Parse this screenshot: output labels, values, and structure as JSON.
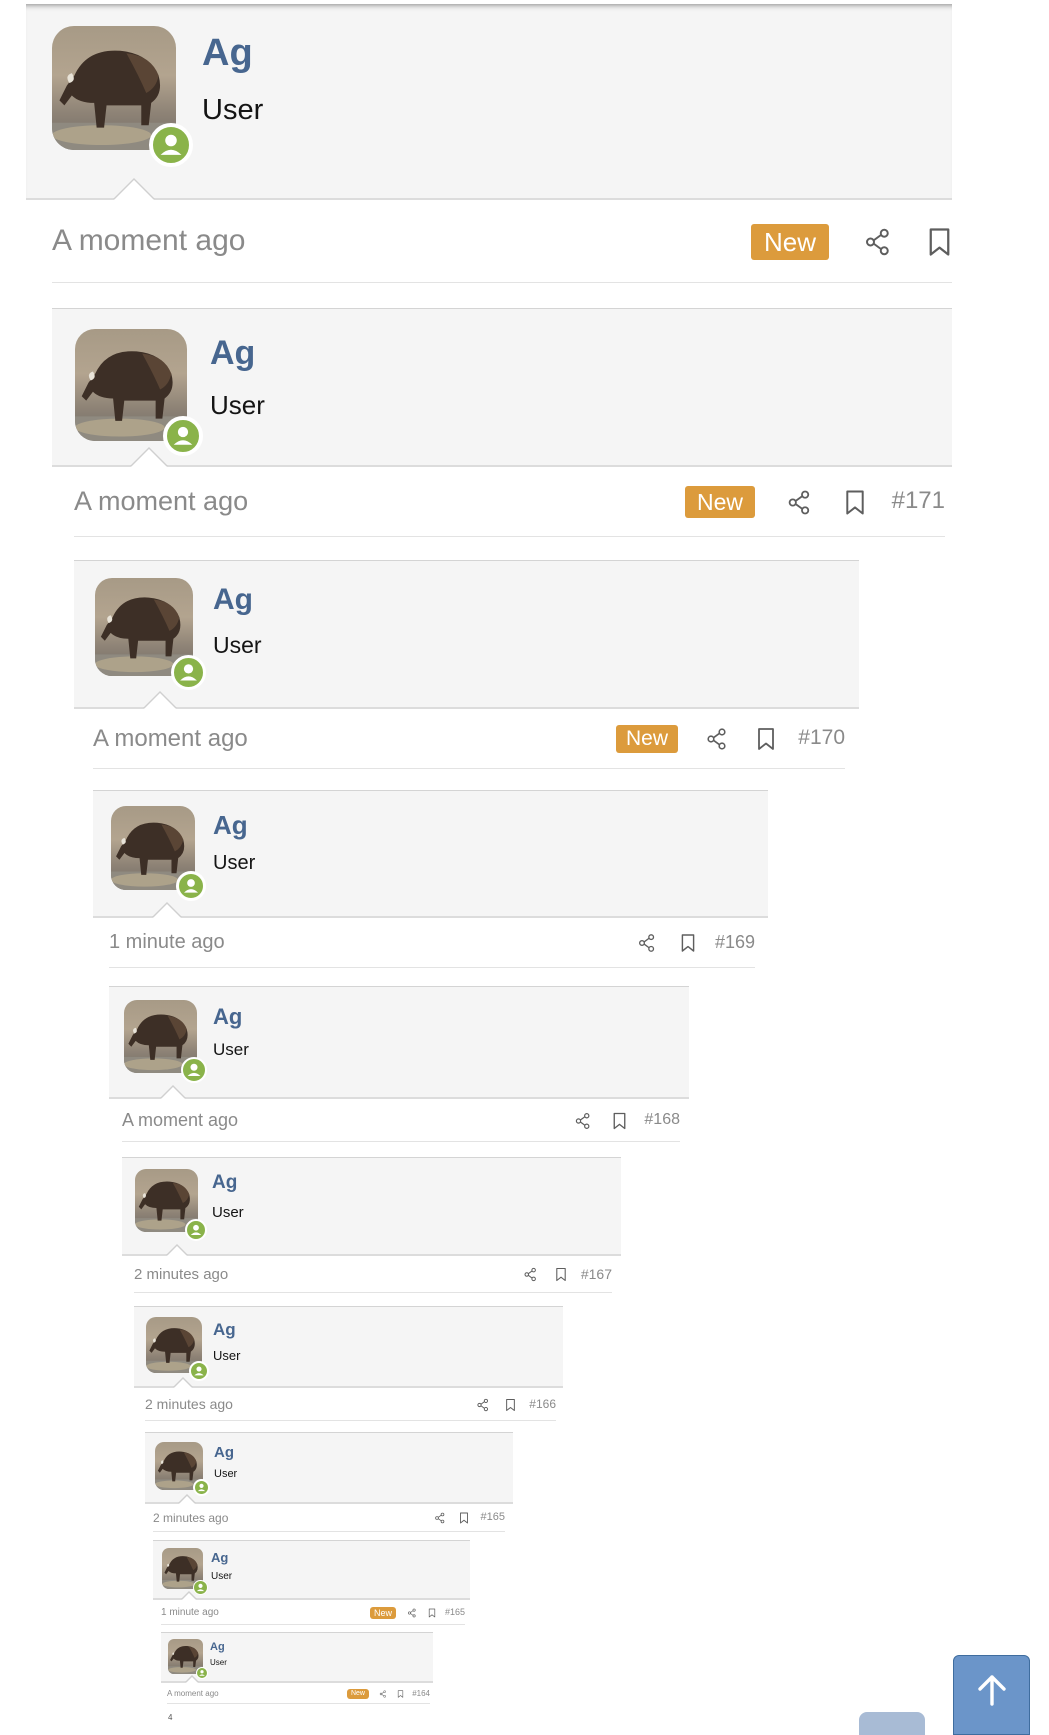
{
  "posts": [
    {
      "name": "Ag",
      "role": "User",
      "time": "A moment ago",
      "new_label": "New",
      "number": ""
    },
    {
      "name": "Ag",
      "role": "User",
      "time": "A moment ago",
      "new_label": "New",
      "number": "#171"
    },
    {
      "name": "Ag",
      "role": "User",
      "time": "A moment ago",
      "new_label": "New",
      "number": "#170"
    },
    {
      "name": "Ag",
      "role": "User",
      "time": "1 minute ago",
      "new_label": "",
      "number": "#169"
    },
    {
      "name": "Ag",
      "role": "User",
      "time": "A moment ago",
      "new_label": "",
      "number": "#168"
    },
    {
      "name": "Ag",
      "role": "User",
      "time": "2 minutes ago",
      "new_label": "",
      "number": "#167"
    },
    {
      "name": "Ag",
      "role": "User",
      "time": "2 minutes ago",
      "new_label": "",
      "number": "#166"
    },
    {
      "name": "Ag",
      "role": "User",
      "time": "2 minutes ago",
      "new_label": "",
      "number": "#165"
    },
    {
      "name": "Ag",
      "role": "User",
      "time": "1 minute ago",
      "new_label": "New",
      "number": "#165"
    },
    {
      "name": "Ag",
      "role": "User",
      "time": "A moment ago",
      "new_label": "New",
      "number": "#164"
    }
  ],
  "footer": {
    "text": "4"
  },
  "icons": {
    "share": "share-icon",
    "bookmark": "bookmark-icon",
    "scroll_top": "arrow-up-icon",
    "status": "user-status-icon"
  },
  "colors": {
    "username": "#47668f",
    "badge": "#dc9b3c",
    "status": "#8ab34a",
    "scroll_button": "#6b95c9"
  }
}
